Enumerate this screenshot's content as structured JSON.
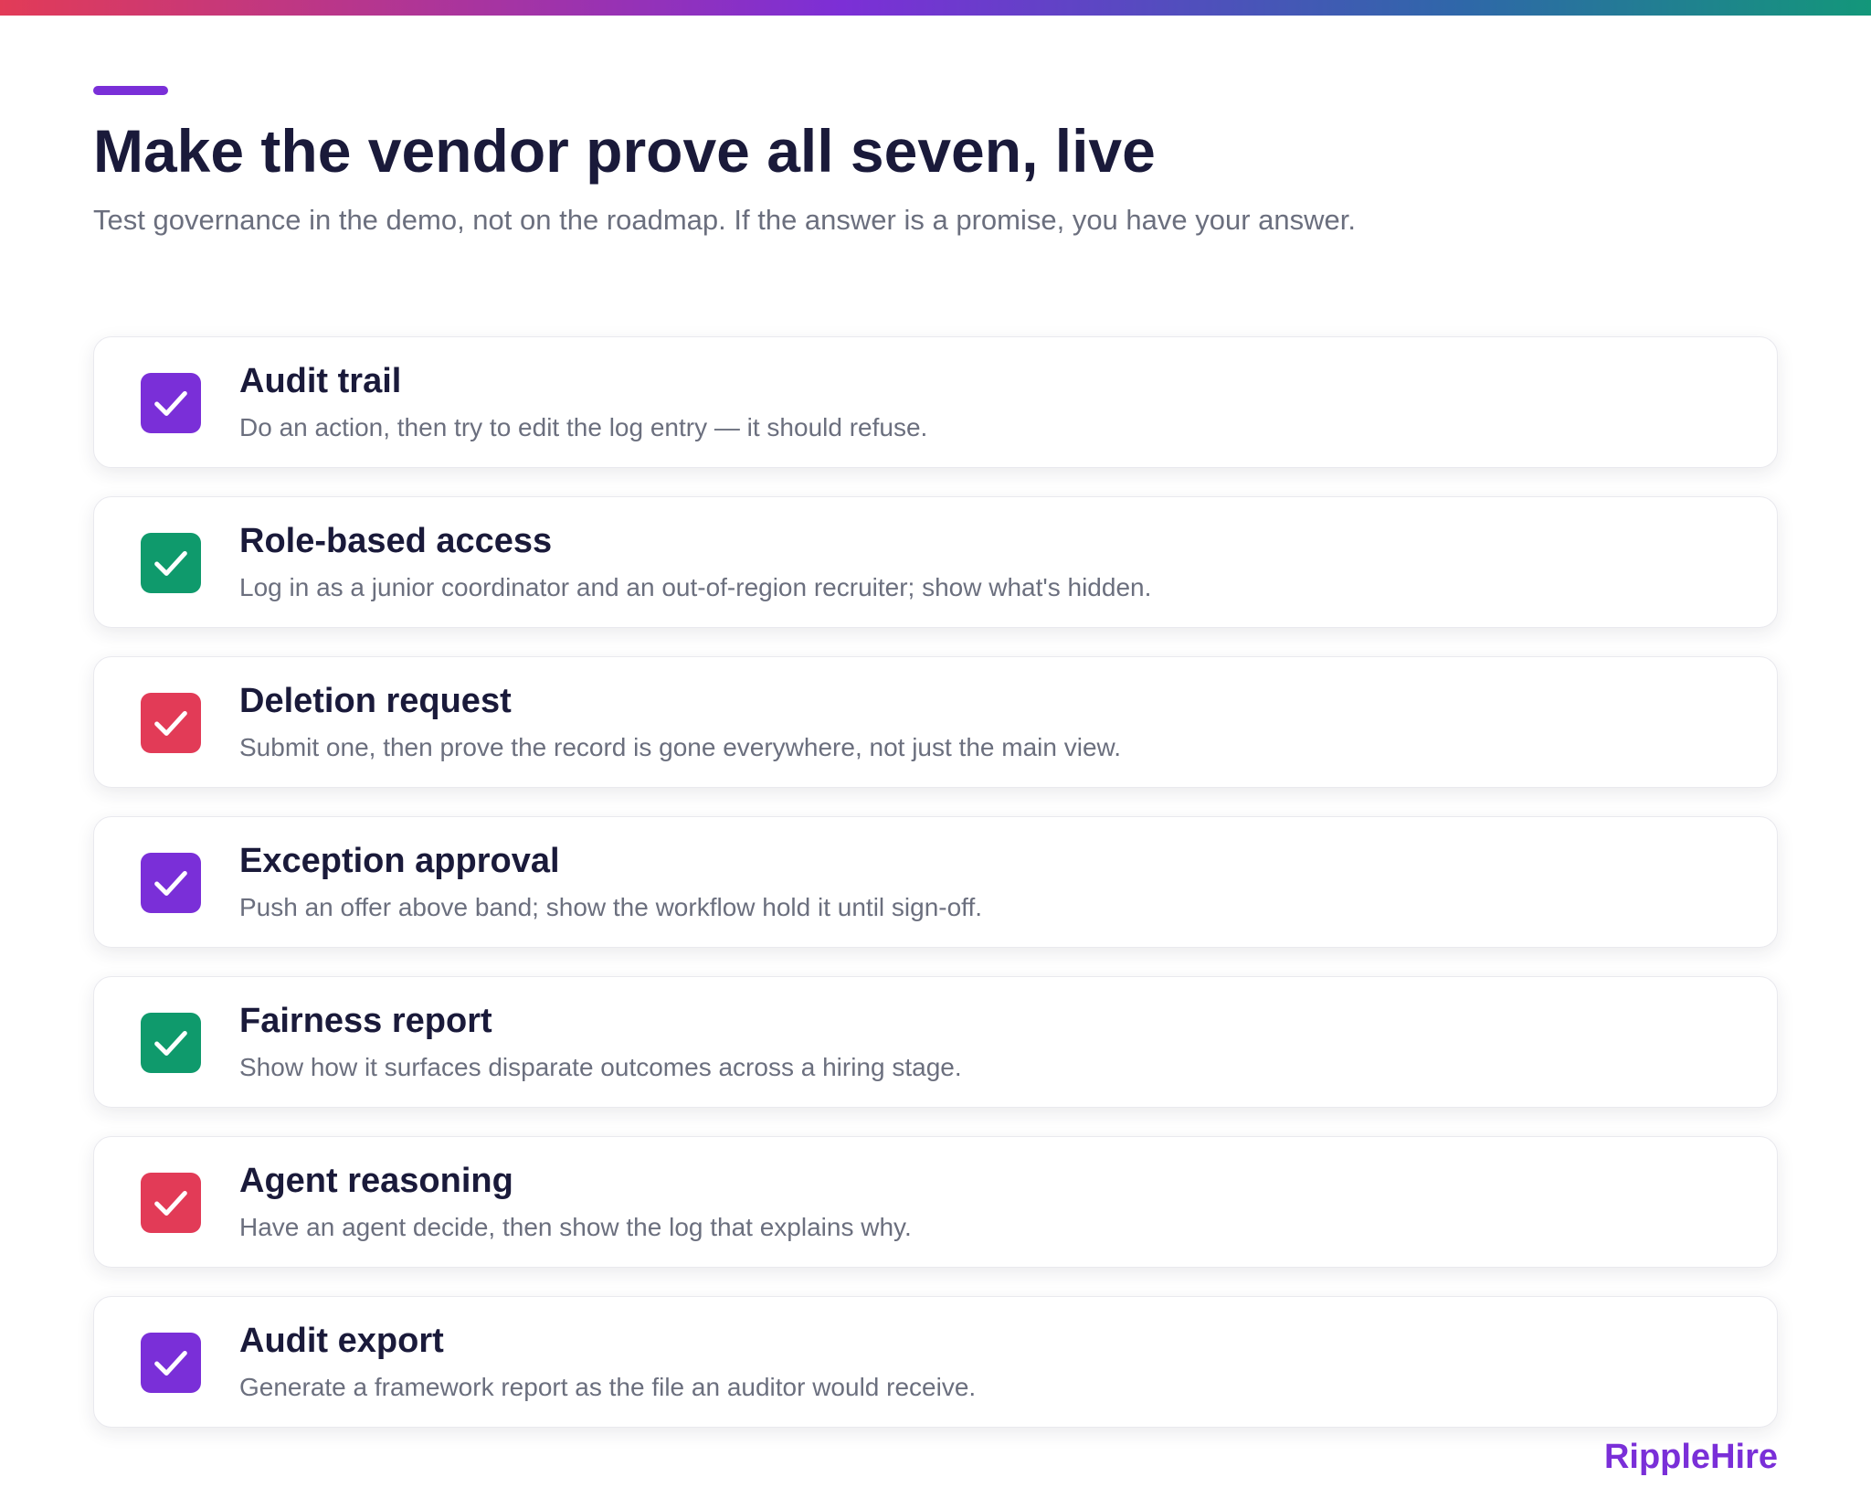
{
  "header": {
    "title": "Make the vendor prove all seven, live",
    "subtitle": "Test governance in the demo, not on the roadmap. If the answer is a promise, you have your answer."
  },
  "colors": {
    "purple": "#7a2fd8",
    "green": "#0f9a6c",
    "red": "#e23b57",
    "title": "#1a1a3a",
    "muted": "#6b6f7e"
  },
  "checklist": {
    "items": [
      {
        "title": "Audit trail",
        "description": "Do an action, then try to edit the log entry — it should refuse.",
        "icon": "checkbox-checked-icon",
        "color": "#7a2fd8"
      },
      {
        "title": "Role-based access",
        "description": "Log in as a junior coordinator and an out-of-region recruiter; show what's hidden.",
        "icon": "checkbox-checked-icon",
        "color": "#0f9a6c"
      },
      {
        "title": "Deletion request",
        "description": "Submit one, then prove the record is gone everywhere, not just the main view.",
        "icon": "checkbox-checked-icon",
        "color": "#e23b57"
      },
      {
        "title": "Exception approval",
        "description": "Push an offer above band; show the workflow hold it until sign-off.",
        "icon": "checkbox-checked-icon",
        "color": "#7a2fd8"
      },
      {
        "title": "Fairness report",
        "description": "Show how it surfaces disparate outcomes across a hiring stage.",
        "icon": "checkbox-checked-icon",
        "color": "#0f9a6c"
      },
      {
        "title": "Agent reasoning",
        "description": "Have an agent decide, then show the log that explains why.",
        "icon": "checkbox-checked-icon",
        "color": "#e23b57"
      },
      {
        "title": "Audit export",
        "description": "Generate a framework report as the file an auditor would receive.",
        "icon": "checkbox-checked-icon",
        "color": "#7a2fd8"
      }
    ]
  },
  "footer": {
    "brand": "RippleHire"
  }
}
